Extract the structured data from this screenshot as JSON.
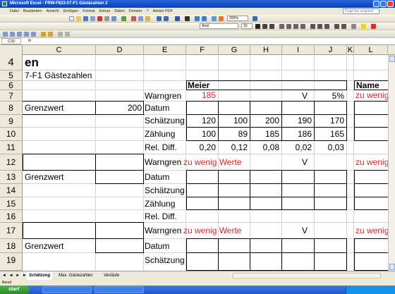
{
  "window": {
    "title": "Microsoft Excel - FRW-F823-07-F1 Gästezahlen 2"
  },
  "menu": [
    "Datei",
    "Bearbeiten",
    "Ansicht",
    "Einfügen",
    "Format",
    "Extras",
    "Daten",
    "Fenster",
    "?",
    "Adobe PDF"
  ],
  "menu_ask_placeholder": "Frage hier eingeben",
  "format_toolbar": {
    "font": "Arial",
    "size": "10",
    "zoom": "200%"
  },
  "formula_bar": {
    "cell_ref": "C32",
    "fx": "fx"
  },
  "columns": [
    "C",
    "D",
    "E",
    "F",
    "G",
    "H",
    "I",
    "J",
    "K",
    "L"
  ],
  "rows": [
    "4",
    "5",
    "6",
    "7",
    "8",
    "9",
    "10",
    "11",
    "12",
    "13",
    "14",
    "15",
    "16",
    "17",
    "18",
    "19"
  ],
  "sheet": {
    "c4": "en",
    "c5": "7-F1 Gästezahlen",
    "f6": "Meier",
    "l6": "Name",
    "e7": "Warngren",
    "f7": "185",
    "i7": "V",
    "j7": "5%",
    "l7": "zu wenig",
    "c8": "Grenzwert",
    "d8": "200",
    "e8": "Datum",
    "e9": "Schätzung",
    "e10": "Zählung",
    "e11": "Rel. Diff.",
    "schaetzung": [
      "120",
      "100",
      "200",
      "190",
      "170"
    ],
    "zaehlung": [
      "100",
      "89",
      "185",
      "186",
      "165"
    ],
    "reldiff": [
      "0,20",
      "0,12",
      "0,08",
      "0,02",
      "0,03"
    ],
    "e12": "Warngren",
    "f12": "zu wenig Werte",
    "i12": "V",
    "l12": "zu wenig",
    "c13": "Grenzwert",
    "e13": "Datum",
    "e14": "Schätzung",
    "e15": "Zählung",
    "e16": "Rel. Diff.",
    "e17": "Warngren",
    "f17": "zu wenig Werte",
    "i17": "V",
    "l17": "zu wenig",
    "c18": "Grenzwert",
    "e18": "Datum",
    "e19": "Schätzung"
  },
  "tabs": {
    "nav": "◄ ◄ ► ►",
    "t1": "Schätzung",
    "t2": "Max. Gästezahlen",
    "t3": "Verläufe"
  },
  "status": "Bereit",
  "taskbar": {
    "start": "start"
  }
}
